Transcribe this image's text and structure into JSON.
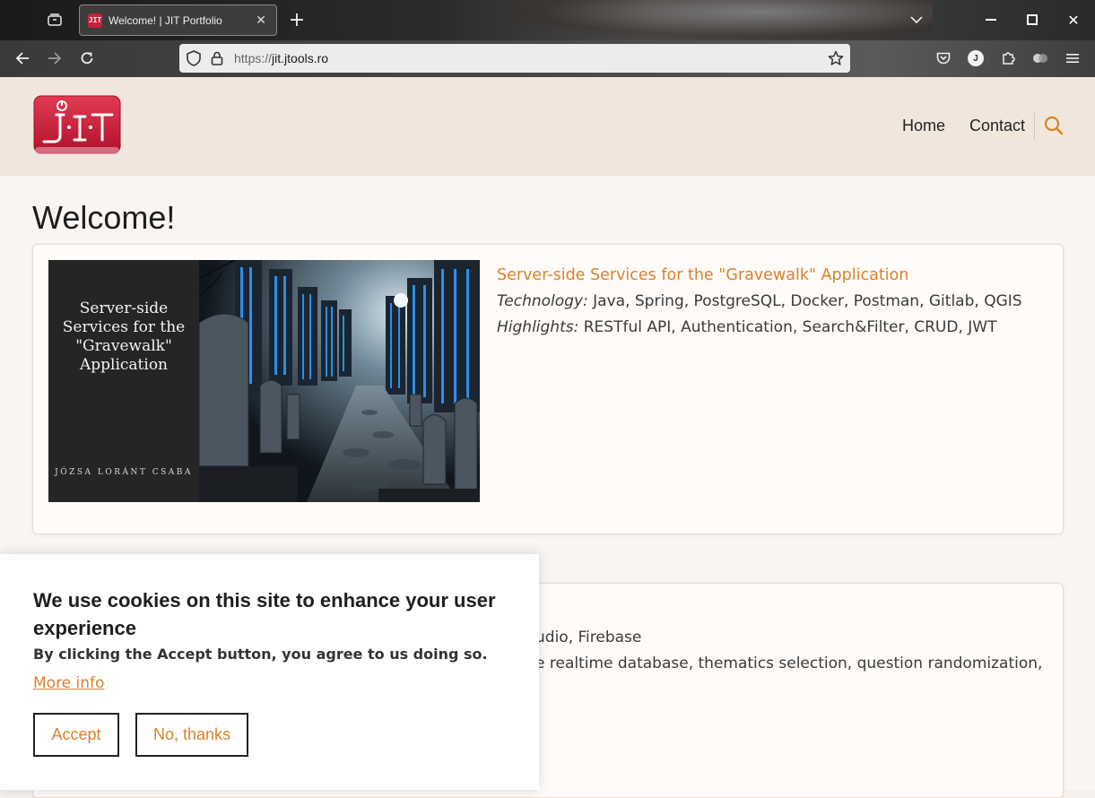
{
  "browser": {
    "tab_title": "Welcome! | JIT Portfolio",
    "favicon_text": "JIT",
    "url_scheme": "https://",
    "url_host": "jit.jtools.ro",
    "profile_initial": "J",
    "icons": {
      "tab_list": "tab-list-icon",
      "close_tab": "close-icon",
      "new_tab": "plus-icon",
      "list_all_tabs": "chevron-down-icon",
      "minimize": "minimize-icon",
      "maximize": "maximize-icon",
      "close_window": "close-icon",
      "back": "arrow-left-icon",
      "forward": "arrow-right-icon",
      "reload": "reload-icon",
      "tracking_protection": "shield-icon",
      "lock": "lock-icon",
      "bookmark": "star-icon",
      "pocket": "pocket-icon",
      "extensions": "puzzle-icon",
      "menu": "hamburger-icon"
    }
  },
  "site": {
    "logo_text": "JIT",
    "nav": {
      "home": "Home",
      "contact": "Contact"
    },
    "accent_color": "#d9822b",
    "header_bg": "#f0e6dc"
  },
  "main": {
    "title": "Welcome!",
    "cards": [
      {
        "image_title": "Server-side Services for the \"Gravewalk\" Application",
        "image_author": "JÓZSA LORÁNT CSABA",
        "link": "Server-side Services for the \"Gravewalk\" Application",
        "technology_label": "Technology:",
        "technology": "Java, Spring, PostgreSQL, Docker, Postman, Gitlab, QGIS",
        "highlights_label": "Highlights:",
        "highlights": "RESTful API, Authentication, Search&Filter, CRUD, JWT"
      },
      {
        "technology_fragment": "udio, Firebase",
        "highlights_fragment": "e realtime database, thematics selection, question randomization,"
      }
    ]
  },
  "cookie_banner": {
    "heading": "We use cookies on this site to enhance your user experience",
    "subtext": "By clicking the Accept button, you agree to us doing so.",
    "more_info": "More info",
    "accept": "Accept",
    "decline": "No, thanks"
  }
}
